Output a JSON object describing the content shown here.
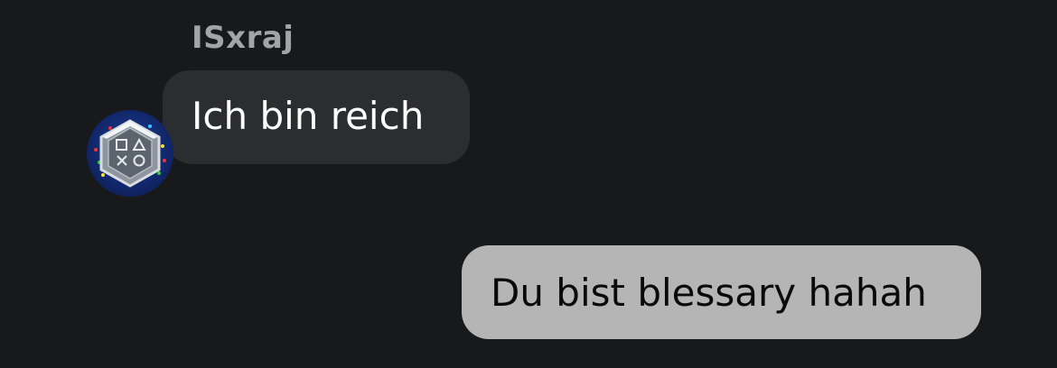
{
  "conversation": {
    "messages": [
      {
        "direction": "incoming",
        "sender": "ISxraj",
        "text": "Ich bin reich",
        "avatar_icon": "playstation-hexagon-badge-icon"
      },
      {
        "direction": "outgoing",
        "text": "Du bist blessary hahah"
      }
    ]
  },
  "colors": {
    "background": "#18191b",
    "incoming_bubble": "#2c2d30",
    "outgoing_bubble": "#b5b5b5",
    "sender_name": "#a3a4a7"
  }
}
